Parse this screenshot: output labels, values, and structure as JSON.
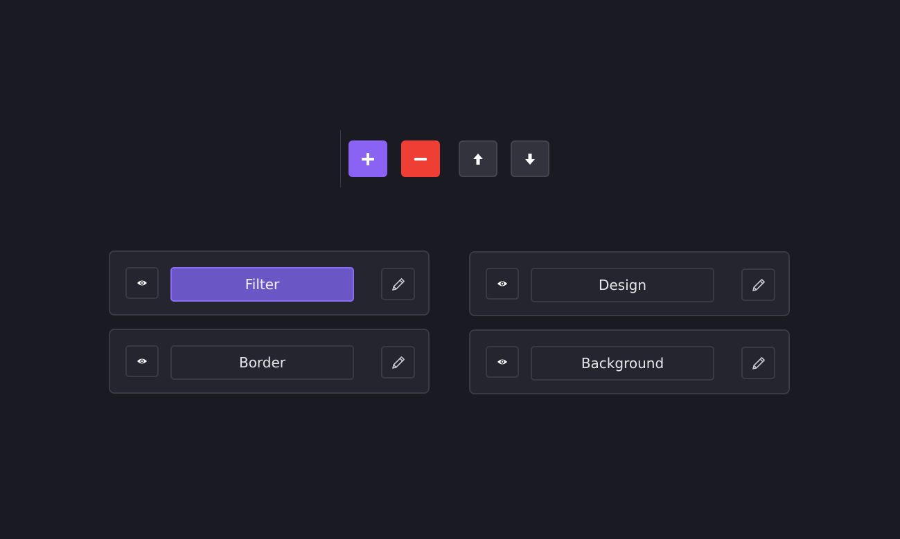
{
  "colors": {
    "background": "#1a1a22",
    "card": "#25252f",
    "border": "#3a3a45",
    "accent": "#8a63f5",
    "accent_active_fill": "#6a56c4",
    "danger": "#ef3e33",
    "neutral_button": "#33333d",
    "text": "#e6e6ea"
  },
  "toolbar": {
    "add_icon": "plus-icon",
    "remove_icon": "minus-icon",
    "move_up_icon": "arrow-up-icon",
    "move_down_icon": "arrow-down-icon"
  },
  "layers": [
    {
      "label": "Filter",
      "active": true,
      "visibility_icon": "eye-icon",
      "edit_icon": "pencil-icon"
    },
    {
      "label": "Design",
      "active": false,
      "visibility_icon": "eye-icon",
      "edit_icon": "pencil-icon"
    },
    {
      "label": "Border",
      "active": false,
      "visibility_icon": "eye-icon",
      "edit_icon": "pencil-icon"
    },
    {
      "label": "Background",
      "active": false,
      "visibility_icon": "eye-icon",
      "edit_icon": "pencil-icon"
    }
  ]
}
